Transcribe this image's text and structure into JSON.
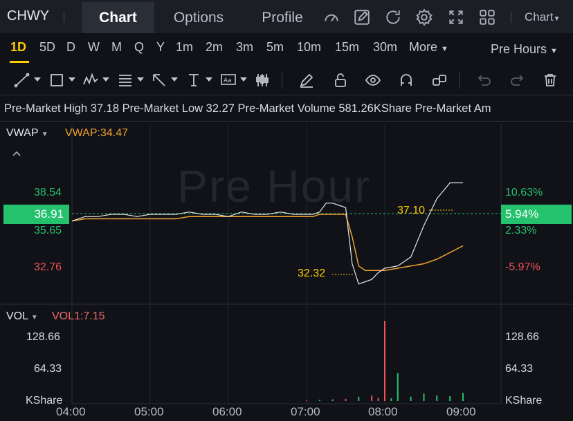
{
  "ticker": "CHWY",
  "tabs": [
    {
      "label": "Chart",
      "active": true
    },
    {
      "label": "Options",
      "active": false
    },
    {
      "label": "Profile",
      "active": false
    }
  ],
  "toolbar_icons": [
    "gauge-icon",
    "edit-icon",
    "refresh-icon",
    "gear-icon",
    "fullscreen-icon",
    "grid-icon"
  ],
  "chart_dropdown_label": "Chart",
  "periods": [
    "1D",
    "5D",
    "D",
    "W",
    "M",
    "Q",
    "Y",
    "1m",
    "2m",
    "3m",
    "5m",
    "10m",
    "15m",
    "30m"
  ],
  "active_period": "1D",
  "more_label": "More",
  "session_label": "Pre Hours",
  "drawing_tools": [
    "trend-line-icon",
    "rectangle-icon",
    "pattern-icon",
    "fib-icon",
    "arrow-icon",
    "measure-icon",
    "text-icon",
    "indicator-icon",
    "pencil-icon",
    "lock-icon",
    "eye-icon",
    "magnet-icon",
    "link-icon",
    "undo-icon",
    "redo-icon",
    "trash-icon"
  ],
  "info": {
    "high_label": "Pre-Market High",
    "high_value": "37.18",
    "low_label": "Pre-Market Low",
    "low_value": "32.27",
    "volume_label": "Pre-Market Volume",
    "volume_value": "581.26KShare",
    "trailing": "Pre-Market Am"
  },
  "indicator": {
    "name": "VWAP",
    "value_text": "VWAP:34.47"
  },
  "watermark": "Pre Hour",
  "current_price": "36.91",
  "current_pct": "5.94%",
  "price_axis_left": [
    "38.54",
    "35.65",
    "32.76"
  ],
  "price_axis_right": [
    "10.63%",
    "2.33%",
    "-5.97%"
  ],
  "annotations": {
    "high": "37.10",
    "low": "32.32"
  },
  "volume_indicator": {
    "name": "VOL",
    "value_text": "VOL1:7.15"
  },
  "volume_axis": [
    "128.66",
    "64.33",
    "KShare"
  ],
  "time_axis": [
    "04:00",
    "05:00",
    "06:00",
    "07:00",
    "08:00",
    "09:00"
  ],
  "colors": {
    "up": "#25c26e",
    "down": "#f0525a",
    "vwap": "#f0a030",
    "price_line": "#e8e8e8",
    "accent": "#ffcc00"
  },
  "chart_data": {
    "type": "line",
    "x": [
      "04:00",
      "04:10",
      "04:20",
      "04:30",
      "04:40",
      "04:50",
      "05:00",
      "05:10",
      "05:20",
      "05:30",
      "05:40",
      "05:50",
      "06:00",
      "06:10",
      "06:20",
      "06:30",
      "06:40",
      "06:50",
      "07:00",
      "07:05",
      "07:10",
      "07:15",
      "07:20",
      "07:25",
      "07:30",
      "07:35",
      "07:40",
      "07:45",
      "07:50",
      "07:55",
      "08:00",
      "08:10",
      "08:20",
      "08:30",
      "08:40",
      "08:50",
      "09:00"
    ],
    "series": [
      {
        "values": [
          35.2,
          35.4,
          35.4,
          35.5,
          35.5,
          35.4,
          35.5,
          35.5,
          35.5,
          35.6,
          35.5,
          35.5,
          35.4,
          35.6,
          35.5,
          35.5,
          35.6,
          35.5,
          35.5,
          35.5,
          35.6,
          36.0,
          36.0,
          35.9,
          35.8,
          33.3,
          32.4,
          32.5,
          32.6,
          32.9,
          33.1,
          33.2,
          33.6,
          35.0,
          36.2,
          36.9,
          36.9
        ]
      },
      {
        "values": [
          35.2,
          35.3,
          35.3,
          35.3,
          35.3,
          35.3,
          35.3,
          35.3,
          35.3,
          35.4,
          35.4,
          35.4,
          35.4,
          35.4,
          35.4,
          35.4,
          35.4,
          35.4,
          35.4,
          35.4,
          35.5,
          35.5,
          35.5,
          35.5,
          35.5,
          34.5,
          33.2,
          33.0,
          33.0,
          33.0,
          33.0,
          33.1,
          33.2,
          33.3,
          33.5,
          33.8,
          34.1
        ]
      }
    ],
    "volume": {
      "x": [
        "07:00",
        "07:10",
        "07:20",
        "07:30",
        "07:40",
        "07:50",
        "07:55",
        "08:00",
        "08:05",
        "08:10",
        "08:20",
        "08:30",
        "08:40",
        "08:50",
        "09:00"
      ],
      "values": [
        1,
        2,
        3,
        4,
        8,
        10,
        6,
        150,
        5,
        52,
        8,
        14,
        10,
        9,
        15
      ],
      "colors": [
        "down",
        "up",
        "up",
        "down",
        "up",
        "down",
        "down",
        "down",
        "up",
        "up",
        "up",
        "up",
        "up",
        "up",
        "up"
      ]
    },
    "ylim": [
      31.5,
      39.5
    ],
    "vol_ylim": [
      0,
      150
    ]
  }
}
